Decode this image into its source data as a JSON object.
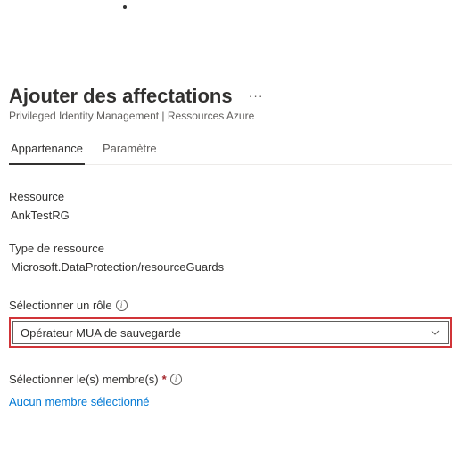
{
  "header": {
    "title": "Ajouter des affectations",
    "breadcrumb": "Privileged Identity Management | Ressources Azure",
    "ellipsis": "···"
  },
  "tabs": {
    "membership": "Appartenance",
    "setting": "Paramètre"
  },
  "form": {
    "resource_label": "Ressource",
    "resource_value": "AnkTestRG",
    "resource_type_label": "Type de ressource",
    "resource_type_value": "Microsoft.DataProtection/resourceGuards",
    "select_role_label": "Sélectionner un rôle",
    "select_role_value": "Opérateur MUA de sauvegarde",
    "select_members_label": "Sélectionner le(s) membre(s)",
    "select_members_link": "Aucun membre sélectionné"
  }
}
